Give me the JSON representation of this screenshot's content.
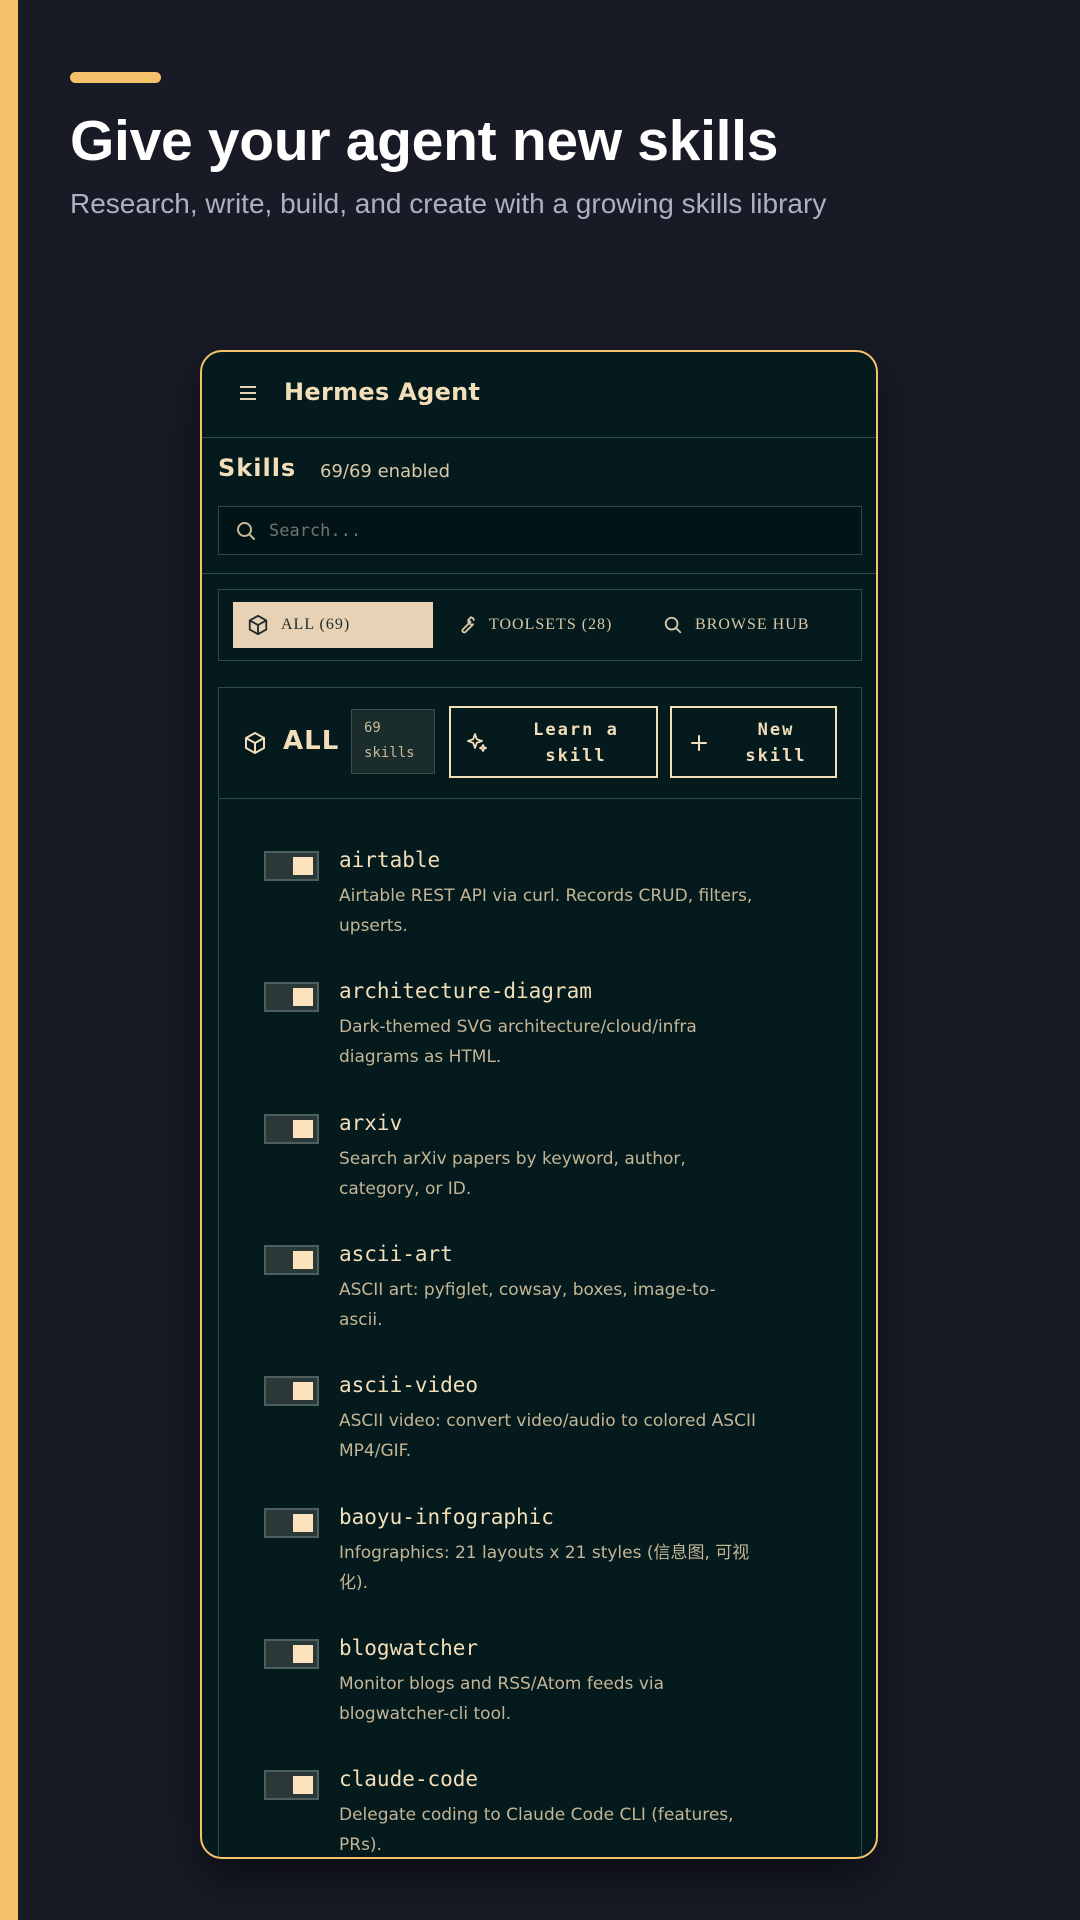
{
  "hero": {
    "title": "Give your agent new skills",
    "subtitle": "Research, write, build, and create with a growing skills library"
  },
  "app": {
    "title": "Hermes Agent"
  },
  "skills_header": {
    "title": "Skills",
    "count": "69/69 enabled"
  },
  "search": {
    "placeholder": "Search...",
    "value": ""
  },
  "tabs": [
    {
      "label": "ALL (69)",
      "icon": "cube-icon",
      "active": true
    },
    {
      "label": "TOOLSETS (28)",
      "icon": "wrench-icon",
      "active": false
    },
    {
      "label": "BROWSE HUB",
      "icon": "search-icon",
      "active": false
    }
  ],
  "panel": {
    "title": "ALL",
    "badge_count": "69",
    "badge_unit": "skills",
    "learn_label": "Learn a\nskill",
    "new_label": "New\nskill"
  },
  "skills": [
    {
      "name": "airtable",
      "description": "Airtable REST API via curl. Records CRUD, filters, upserts.",
      "enabled": true
    },
    {
      "name": "architecture-diagram",
      "description": "Dark-themed SVG architecture/cloud/infra diagrams as HTML.",
      "enabled": true
    },
    {
      "name": "arxiv",
      "description": "Search arXiv papers by keyword, author, category, or ID.",
      "enabled": true
    },
    {
      "name": "ascii-art",
      "description": "ASCII art: pyfiglet, cowsay, boxes, image-to-ascii.",
      "enabled": true
    },
    {
      "name": "ascii-video",
      "description": "ASCII video: convert video/audio to colored ASCII MP4/GIF.",
      "enabled": true
    },
    {
      "name": "baoyu-infographic",
      "description": "Infographics: 21 layouts x 21 styles (信息图, 可视化).",
      "enabled": true
    },
    {
      "name": "blogwatcher",
      "description": "Monitor blogs and RSS/Atom feeds via blogwatcher-cli tool.",
      "enabled": true
    },
    {
      "name": "claude-code",
      "description": "Delegate coding to Claude Code CLI (features, PRs).",
      "enabled": true
    }
  ],
  "colors": {
    "accent": "#f5c26b",
    "page_bg": "#181a26",
    "app_bg": "#041a1c",
    "cream": "#f3deba",
    "active_tab": "#e8d2b5"
  }
}
